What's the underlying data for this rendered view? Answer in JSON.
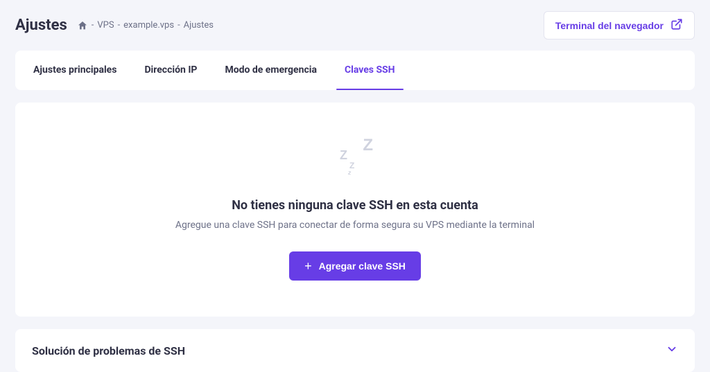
{
  "header": {
    "title": "Ajustes",
    "breadcrumb": [
      " - ",
      "VPS",
      " - ",
      "example.vps",
      " - ",
      "Ajustes"
    ],
    "terminal_btn": "Terminal del navegador"
  },
  "tabs": [
    {
      "label": "Ajustes principales",
      "active": false
    },
    {
      "label": "Dirección IP",
      "active": false
    },
    {
      "label": "Modo de emergencia",
      "active": false
    },
    {
      "label": "Claves SSH",
      "active": true
    }
  ],
  "empty": {
    "title": "No tienes ninguna clave SSH en esta cuenta",
    "subtitle": "Agregue una clave SSH para conectar de forma segura su VPS mediante la terminal",
    "button": "Agregar clave SSH"
  },
  "accordion": {
    "title": "Solución de problemas de SSH"
  }
}
